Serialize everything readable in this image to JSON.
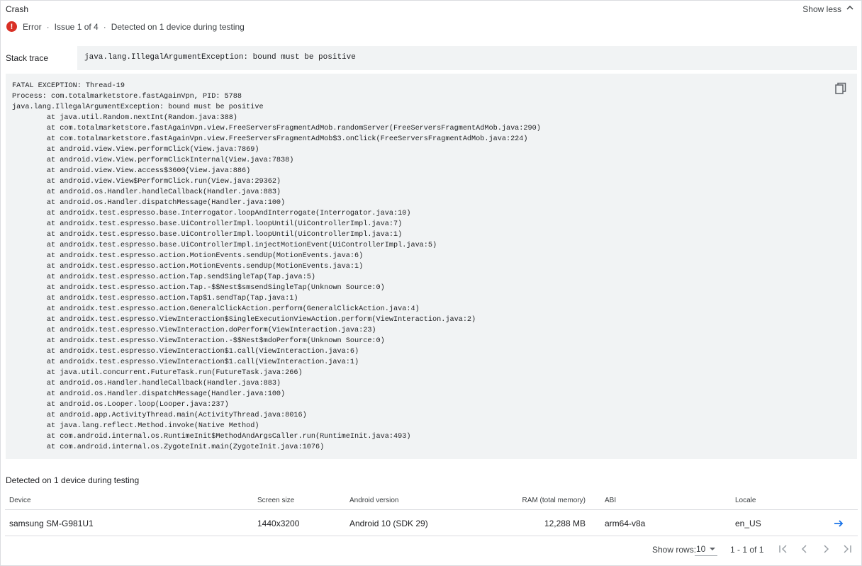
{
  "header": {
    "title": "Crash",
    "show_less_label": "Show less"
  },
  "status": {
    "severity": "Error",
    "issue": "Issue 1 of 4",
    "detected": "Detected on 1 device during testing",
    "separator": "·",
    "error_color": "#d93025"
  },
  "stack_trace": {
    "label": "Stack trace",
    "summary": "java.lang.IllegalArgumentException: bound must be positive",
    "full_text": "FATAL EXCEPTION: Thread-19\nProcess: com.totalmarketstore.fastAgainVpn, PID: 5788\njava.lang.IllegalArgumentException: bound must be positive\n\tat java.util.Random.nextInt(Random.java:388)\n\tat com.totalmarketstore.fastAgainVpn.view.FreeServersFragmentAdMob.randomServer(FreeServersFragmentAdMob.java:290)\n\tat com.totalmarketstore.fastAgainVpn.view.FreeServersFragmentAdMob$3.onClick(FreeServersFragmentAdMob.java:224)\n\tat android.view.View.performClick(View.java:7869)\n\tat android.view.View.performClickInternal(View.java:7838)\n\tat android.view.View.access$3600(View.java:886)\n\tat android.view.View$PerformClick.run(View.java:29362)\n\tat android.os.Handler.handleCallback(Handler.java:883)\n\tat android.os.Handler.dispatchMessage(Handler.java:100)\n\tat androidx.test.espresso.base.Interrogator.loopAndInterrogate(Interrogator.java:10)\n\tat androidx.test.espresso.base.UiControllerImpl.loopUntil(UiControllerImpl.java:7)\n\tat androidx.test.espresso.base.UiControllerImpl.loopUntil(UiControllerImpl.java:1)\n\tat androidx.test.espresso.base.UiControllerImpl.injectMotionEvent(UiControllerImpl.java:5)\n\tat androidx.test.espresso.action.MotionEvents.sendUp(MotionEvents.java:6)\n\tat androidx.test.espresso.action.MotionEvents.sendUp(MotionEvents.java:1)\n\tat androidx.test.espresso.action.Tap.sendSingleTap(Tap.java:5)\n\tat androidx.test.espresso.action.Tap.-$$Nest$smsendSingleTap(Unknown Source:0)\n\tat androidx.test.espresso.action.Tap$1.sendTap(Tap.java:1)\n\tat androidx.test.espresso.action.GeneralClickAction.perform(GeneralClickAction.java:4)\n\tat androidx.test.espresso.ViewInteraction$SingleExecutionViewAction.perform(ViewInteraction.java:2)\n\tat androidx.test.espresso.ViewInteraction.doPerform(ViewInteraction.java:23)\n\tat androidx.test.espresso.ViewInteraction.-$$Nest$mdoPerform(Unknown Source:0)\n\tat androidx.test.espresso.ViewInteraction$1.call(ViewInteraction.java:6)\n\tat androidx.test.espresso.ViewInteraction$1.call(ViewInteraction.java:1)\n\tat java.util.concurrent.FutureTask.run(FutureTask.java:266)\n\tat android.os.Handler.handleCallback(Handler.java:883)\n\tat android.os.Handler.dispatchMessage(Handler.java:100)\n\tat android.os.Looper.loop(Looper.java:237)\n\tat android.app.ActivityThread.main(ActivityThread.java:8016)\n\tat java.lang.reflect.Method.invoke(Native Method)\n\tat com.android.internal.os.RuntimeInit$MethodAndArgsCaller.run(RuntimeInit.java:493)\n\tat com.android.internal.os.ZygoteInit.main(ZygoteInit.java:1076)",
    "copy_icon": "copy-icon"
  },
  "devices": {
    "heading": "Detected on 1 device during testing",
    "columns": {
      "device": "Device",
      "screen": "Screen size",
      "android": "Android version",
      "ram": "RAM (total memory)",
      "abi": "ABI",
      "locale": "Locale"
    },
    "rows": [
      {
        "device": "samsung SM-G981U1",
        "screen": "1440x3200",
        "android": "Android 10 (SDK 29)",
        "ram": "12,288 MB",
        "abi": "arm64-v8a",
        "locale": "en_US"
      }
    ],
    "link_color": "#1a73e8"
  },
  "pagination": {
    "rows_label": "Show rows:",
    "rows_value": "10",
    "range": "1 - 1 of 1"
  }
}
